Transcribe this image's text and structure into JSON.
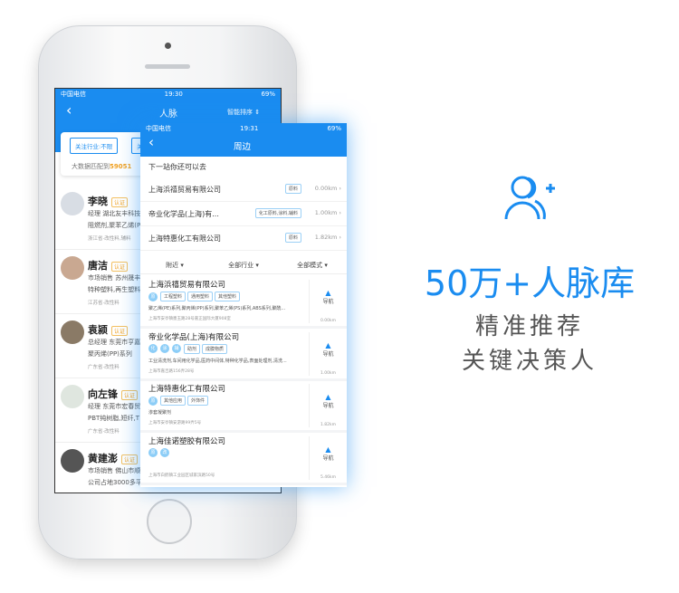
{
  "colors": {
    "accent": "#1a8cf0",
    "badge": "#f0a020"
  },
  "back_screen": {
    "status": {
      "carrier": "中国电信",
      "time": "19:30",
      "battery": "69%"
    },
    "title": "人脉",
    "sort": "智能排序",
    "filter_label": "关注行业:不限",
    "filter2": "关",
    "match_text": "大数据匹配到",
    "match_count": "59051",
    "contacts": [
      {
        "name": "李晓",
        "badge": "认证",
        "line1": "经理 湖北友丰科技",
        "line2": "阻燃剂,聚苯乙烯(P",
        "meta": "浙江省·改性料,辅料"
      },
      {
        "name": "唐洁",
        "badge": "认证",
        "line1": "市场销售 苏州晟丰",
        "line2": "特种塑料,再生塑料",
        "meta": "江苏省·改性料"
      },
      {
        "name": "袁颍",
        "badge": "认证",
        "line1": "总经理 东莞市亨嘉",
        "line2": "聚丙烯(PP)系列",
        "meta": "广东省·改性料"
      },
      {
        "name": "向左锋",
        "badge": "认证",
        "line1": "经理 东莞市宏春贸",
        "line2": "PBT纯树脂,短纤,T",
        "meta": "广东省·改性料"
      },
      {
        "name": "黄建澎",
        "badge": "认证",
        "line1": "市场销售 佛山市顺",
        "line2": "公司占地3000多平",
        "meta": ""
      }
    ]
  },
  "front_screen": {
    "status": {
      "carrier": "中国电信",
      "time": "19:31",
      "battery": "69%"
    },
    "title": "周边",
    "section": "下一站你还可以去",
    "suggestions": [
      {
        "name": "上海浜禧贸易有限公司",
        "tag": "原料",
        "dist": "0.00km"
      },
      {
        "name": "帝业化学品(上海)有...",
        "tag": "化工原料,涂料,辅料",
        "dist": "1.00km"
      },
      {
        "name": "上海特惠化工有限公司",
        "tag": "原料",
        "dist": "1.82km"
      }
    ],
    "filters": [
      "附近",
      "全部行业",
      "全部模式"
    ],
    "nav_label": "导航",
    "companies": [
      {
        "name": "上海浜禧贸易有限公司",
        "circles": [
          "原"
        ],
        "tags": [
          "工程塑料",
          "通用塑料",
          "其他塑料"
        ],
        "products": "聚乙烯(PE)系列,聚丙烯(PP)系列,聚苯乙烯(PS)系列,ABS系列,聚酰...",
        "address": "上海市安亭镇墨玉路28号嘉正国际大厦908室",
        "dist": "0.00km"
      },
      {
        "name": "帝业化学品(上海)有限公司",
        "circles": [
          "化",
          "涂",
          "辅"
        ],
        "tags": [
          "助剂",
          "成膜物质"
        ],
        "products": "工业清洗剂,车间用化学品,医药中间体,特种化学品,表面处理剂,清洗...",
        "address": "上海市嘉吉路156弄28号",
        "dist": "1.00km"
      },
      {
        "name": "上海特惠化工有限公司",
        "circles": [
          "原"
        ],
        "tags": [
          "其他应用",
          "外饰件"
        ],
        "products": "渗套凝聚剂",
        "address": "上海市安亭镇安游路99弄5号",
        "dist": "1.82km"
      },
      {
        "name": "上海佳诺塑胶有限公司",
        "circles": [
          "原",
          "改"
        ],
        "tags": [],
        "products": "",
        "address": "上海市白鹤镇工业园区城家滨路50号",
        "dist": "5.46km"
      }
    ]
  },
  "promo": {
    "icon": "add-user-icon",
    "headline": "50万+人脉库",
    "line1": "精准推荐",
    "line2": "关键决策人"
  }
}
